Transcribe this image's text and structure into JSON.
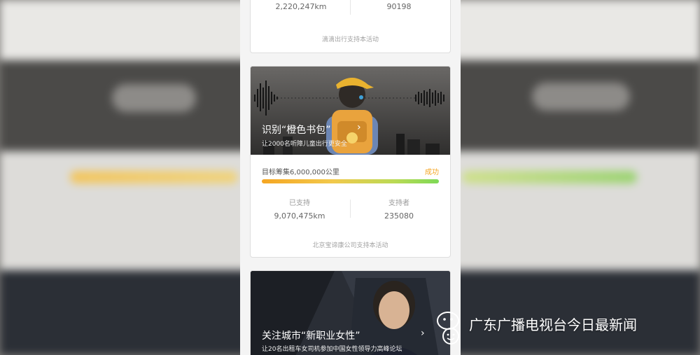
{
  "card_top": {
    "stats": [
      {
        "value": "2,220,247km"
      },
      {
        "value": "90198"
      }
    ],
    "sponsor": "滴滴出行支持本活动"
  },
  "card_main": {
    "banner_title": "识别“橙色书包”",
    "banner_subtitle": "让2000名听障儿童出行更安全",
    "goal_text": "目标筹集6,000,000公里",
    "status": "成功",
    "progress": 1.0,
    "stats": [
      {
        "label": "已支持",
        "value": "9,070,475km"
      },
      {
        "label": "支持者",
        "value": "235080"
      }
    ],
    "sponsor": "北京宝谛康公司支持本活动"
  },
  "card_bottom": {
    "banner_title": "关注城市“新职业女性”",
    "banner_subtitle": "让20名出租车女司机参加中国女性领导力高峰论坛"
  },
  "watermark": {
    "text": "广东广播电视台今日最新闻"
  },
  "colors": {
    "accent": "#f5a623",
    "progress_end": "#7ed957",
    "card_bg": "#ffffff"
  }
}
